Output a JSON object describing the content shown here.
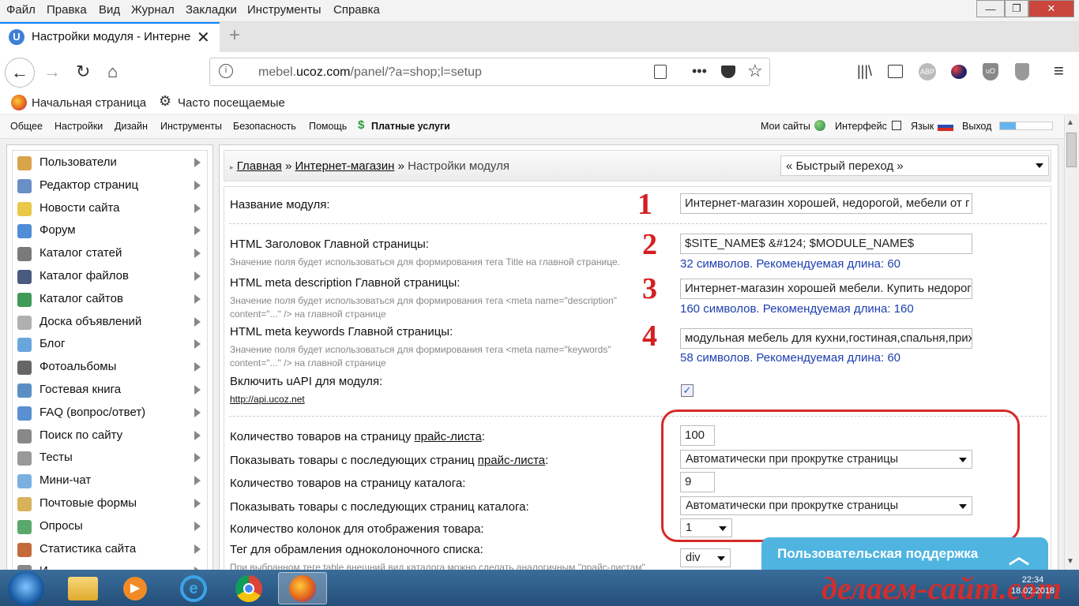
{
  "menu": [
    "Файл",
    "Правка",
    "Вид",
    "Журнал",
    "Закладки",
    "Инструменты",
    "Справка"
  ],
  "tab": {
    "title": "Настройки модуля - Интерне",
    "icon": "U"
  },
  "url": {
    "prefix": "mebel.",
    "domain": "ucoz.com",
    "path": "/panel/?a=shop;l=setup"
  },
  "bookmarks": {
    "home": "Начальная страница",
    "frequent": "Часто посещаемые"
  },
  "ucoz_nav": {
    "left": [
      "Общее",
      "Настройки",
      "Дизайн",
      "Инструменты",
      "Безопасность",
      "Помощь"
    ],
    "paid": "Платные услуги",
    "my_sites": "Мои сайты",
    "interface": "Интерфейс",
    "language": "Язык",
    "logout": "Выход",
    "progress": 0.3
  },
  "sidebar": [
    {
      "label": "Пользователи",
      "icon": "users-icon",
      "color": "#d9a44c"
    },
    {
      "label": "Редактор страниц",
      "icon": "pencil-icon",
      "color": "#6a8fc7"
    },
    {
      "label": "Новости сайта",
      "icon": "bulb-icon",
      "color": "#e9c84a"
    },
    {
      "label": "Форум",
      "icon": "chat-icon",
      "color": "#4f8dd6"
    },
    {
      "label": "Каталог статей",
      "icon": "pen-icon",
      "color": "#7a7a7a"
    },
    {
      "label": "Каталог файлов",
      "icon": "floppy-icon",
      "color": "#4a5b80"
    },
    {
      "label": "Каталог сайтов",
      "icon": "globe-icon",
      "color": "#3e9a55"
    },
    {
      "label": "Доска объявлений",
      "icon": "document-icon",
      "color": "#b0b0b0"
    },
    {
      "label": "Блог",
      "icon": "cog-icon",
      "color": "#6aa6de"
    },
    {
      "label": "Фотоальбомы",
      "icon": "camera-icon",
      "color": "#666666"
    },
    {
      "label": "Гостевая книга",
      "icon": "book-icon",
      "color": "#5b8fc4"
    },
    {
      "label": "FAQ (вопрос/ответ)",
      "icon": "question-icon",
      "color": "#5a8fd0"
    },
    {
      "label": "Поиск по сайту",
      "icon": "search-icon",
      "color": "#888888"
    },
    {
      "label": "Тесты",
      "icon": "list-icon",
      "color": "#999999"
    },
    {
      "label": "Мини-чат",
      "icon": "chat-bubble-icon",
      "color": "#7ab0e0"
    },
    {
      "label": "Почтовые формы",
      "icon": "mail-icon",
      "color": "#d8b25a"
    },
    {
      "label": "Опросы",
      "icon": "chart-icon",
      "color": "#5aa86a"
    },
    {
      "label": "Статистика сайта",
      "icon": "stats-icon",
      "color": "#c46a3a"
    },
    {
      "label": "И",
      "icon": "more-icon",
      "color": "#888888"
    }
  ],
  "breadcrumb": {
    "home": "Главная",
    "sep": "»",
    "shop": "Интернет-магазин",
    "current": "Настройки модуля"
  },
  "quick_jump": "« Быстрый переход »",
  "form": {
    "module_name": {
      "label": "Название модуля:",
      "value": "Интернет-магазин хорошей, недорогой, мебели от г",
      "num": "1"
    },
    "html_title": {
      "label": "HTML Заголовок Главной страницы:",
      "hint": "Значение поля будет использоваться для формирования тега Title на главной странице.",
      "value": "$SITE_NAME$ &#124; $MODULE_NAME$",
      "count": "32 символов. Рекомендуемая длина: 60",
      "num": "2"
    },
    "meta_desc": {
      "label": "HTML meta description Главной страницы:",
      "hint1": "Значение поля будет использоваться для формирования тега <meta name=\"description\"",
      "hint2": "content=\"...\" /> на главной странице",
      "value": "Интернет-магазин хорошей мебели. Купить недорог",
      "count": "160 символов. Рекомендуемая длина: 160",
      "num": "3"
    },
    "meta_keys": {
      "label": "HTML meta keywords Главной страницы:",
      "hint1": "Значение поля будет использоваться для формирования тега <meta name=\"keywords\"",
      "hint2": "content=\"...\" /> на главной странице",
      "value": "модульная мебель для кухни,гостиная,спальня,прих",
      "count": "58 символов. Рекомендуемая длина: 60",
      "num": "4"
    },
    "uapi": {
      "label": "Включить uAPI для модуля:",
      "link": "http://api.ucoz.net",
      "checked": "✓"
    },
    "price_per_page": {
      "label_pre": "Количество товаров на страницу ",
      "label_link": "прайс-листа",
      "label_post": ":",
      "value": "100"
    },
    "price_next": {
      "label_pre": "Показывать товары с последующих страниц ",
      "label_link": "прайс-листа",
      "label_post": ":",
      "value": "Автоматически при прокрутке страницы"
    },
    "catalog_per_page": {
      "label": "Количество товаров на страницу каталога:",
      "value": "9"
    },
    "catalog_next": {
      "label": "Показывать товары с последующих страниц каталога:",
      "value": "Автоматически при прокрутке страницы"
    },
    "columns": {
      "label": "Количество колонок для отображения товара:",
      "value": "1"
    },
    "wrap_tag": {
      "label": "Тег для обрамления одноколоночного списка:",
      "hint": "При выбранном теге table внешний вид каталога можно сделать аналогичным \"прайс-листам\"",
      "value": "div"
    }
  },
  "support": "Пользовательская поддержка",
  "watermark": "делаем-сайт.com",
  "clock": {
    "time": "22:34",
    "date": "18.02.2018"
  }
}
